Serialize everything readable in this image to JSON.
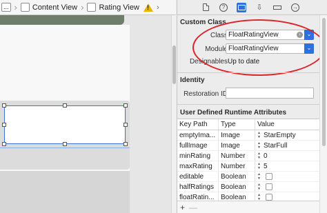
{
  "jumpbar": {
    "overflow": "...",
    "content_view": "Content View",
    "rating_view": "Rating View",
    "warning_icon": "warning-triangle-icon",
    "forward_icon": "chevron-right-icon"
  },
  "inspector": {
    "tabs": [
      {
        "icon": "file-icon",
        "active": false
      },
      {
        "icon": "help-icon",
        "active": false
      },
      {
        "icon": "identity-icon",
        "active": true
      },
      {
        "icon": "attributes-icon",
        "active": false
      },
      {
        "icon": "size-icon",
        "active": false
      },
      {
        "icon": "connections-icon",
        "active": false
      }
    ],
    "custom_class": {
      "title": "Custom Class",
      "class_label": "Class",
      "class_value": "FloatRatingView",
      "module_label": "Module",
      "module_value": "FloatRatingView",
      "designables_label": "Designables",
      "designables_value": "Up to date"
    },
    "identity": {
      "title": "Identity",
      "restoration_id_label": "Restoration ID",
      "restoration_id_value": ""
    },
    "runtime_attributes": {
      "title": "User Defined Runtime Attributes",
      "columns": [
        "Key Path",
        "Type",
        "Value"
      ],
      "rows": [
        {
          "key": "emptyIma...",
          "type": "Image",
          "value": "StarEmpty",
          "kind": "combo"
        },
        {
          "key": "fullImage",
          "type": "Image",
          "value": "StarFull",
          "kind": "combo"
        },
        {
          "key": "minRating",
          "type": "Number",
          "value": "0",
          "kind": "stepper"
        },
        {
          "key": "maxRating",
          "type": "Number",
          "value": "5",
          "kind": "stepper"
        },
        {
          "key": "editable",
          "type": "Boolean",
          "value": "",
          "kind": "checkbox"
        },
        {
          "key": "halfRatings",
          "type": "Boolean",
          "value": "",
          "kind": "checkbox"
        },
        {
          "key": "floatRatin...",
          "type": "Boolean",
          "value": "",
          "kind": "checkbox"
        }
      ],
      "add_label": "+",
      "remove_label": "—"
    }
  },
  "colors": {
    "accent": "#2f6fde",
    "highlight": "#d9262c",
    "selection": "#3d6fd6"
  }
}
